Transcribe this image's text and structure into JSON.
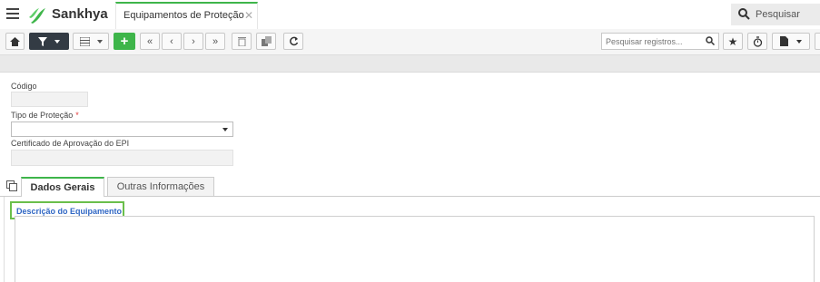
{
  "brand": {
    "name": "Sankhya"
  },
  "header": {
    "tab_title": "Equipamentos de Proteção",
    "search_placeholder": "Pesquisar"
  },
  "toolbar": {
    "record_search_placeholder": "Pesquisar registros..."
  },
  "form": {
    "codigo_label": "Código",
    "codigo_value": "",
    "tipo_label": "Tipo de Proteção",
    "tipo_required_mark": "*",
    "tipo_value": "",
    "certificado_label": "Certificado de Aprovação do EPI",
    "certificado_value": ""
  },
  "tabs": [
    {
      "label": "Dados Gerais",
      "active": true
    },
    {
      "label": "Outras Informações",
      "active": false
    }
  ],
  "details": {
    "description_label": "Descrição do Equipamento",
    "description_value": ""
  },
  "colors": {
    "accent_green": "#3eb54a",
    "link_blue": "#3067c4",
    "dark_button": "#333b44",
    "required_red": "#e23b3b"
  }
}
